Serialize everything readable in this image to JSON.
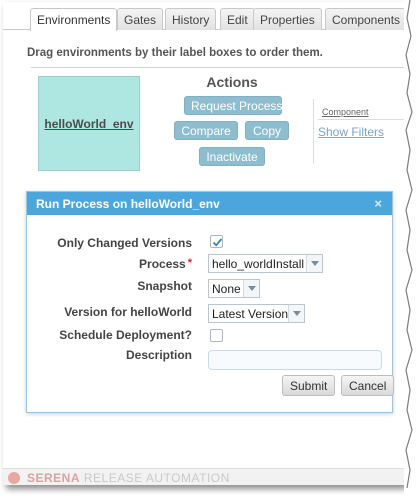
{
  "tabs": [
    "Environments",
    "Gates",
    "History",
    "Edit",
    "Properties",
    "Components"
  ],
  "hint": "Drag environments by their label boxes to order them.",
  "environment": {
    "name": "helloWorld_env",
    "color": "#aee6e1"
  },
  "actions": {
    "title": "Actions",
    "request_process": "Request Process",
    "compare": "Compare",
    "copy": "Copy",
    "inactivate": "Inactivate",
    "button_color": "#8dbdcf"
  },
  "components_panel": {
    "label": "Component",
    "show_filters": "Show Filters"
  },
  "dialog": {
    "title": "Run Process on helloWorld_env",
    "close": "×",
    "header_color": "#4aa6dd",
    "fields": {
      "only_changed_label": "Only Changed Versions",
      "only_changed_checked": true,
      "process_label": "Process",
      "required_mark": "*",
      "process_value": "hello_worldInstall",
      "snapshot_label": "Snapshot",
      "snapshot_value": "None",
      "version_label": "Version for helloWorld",
      "version_value": "Latest Version",
      "schedule_label": "Schedule Deployment?",
      "schedule_checked": false,
      "description_label": "Description",
      "description_value": ""
    },
    "submit": "Submit",
    "cancel": "Cancel"
  },
  "footer": {
    "brand": "SERENA",
    "product": "RELEASE AUTOMATION"
  }
}
